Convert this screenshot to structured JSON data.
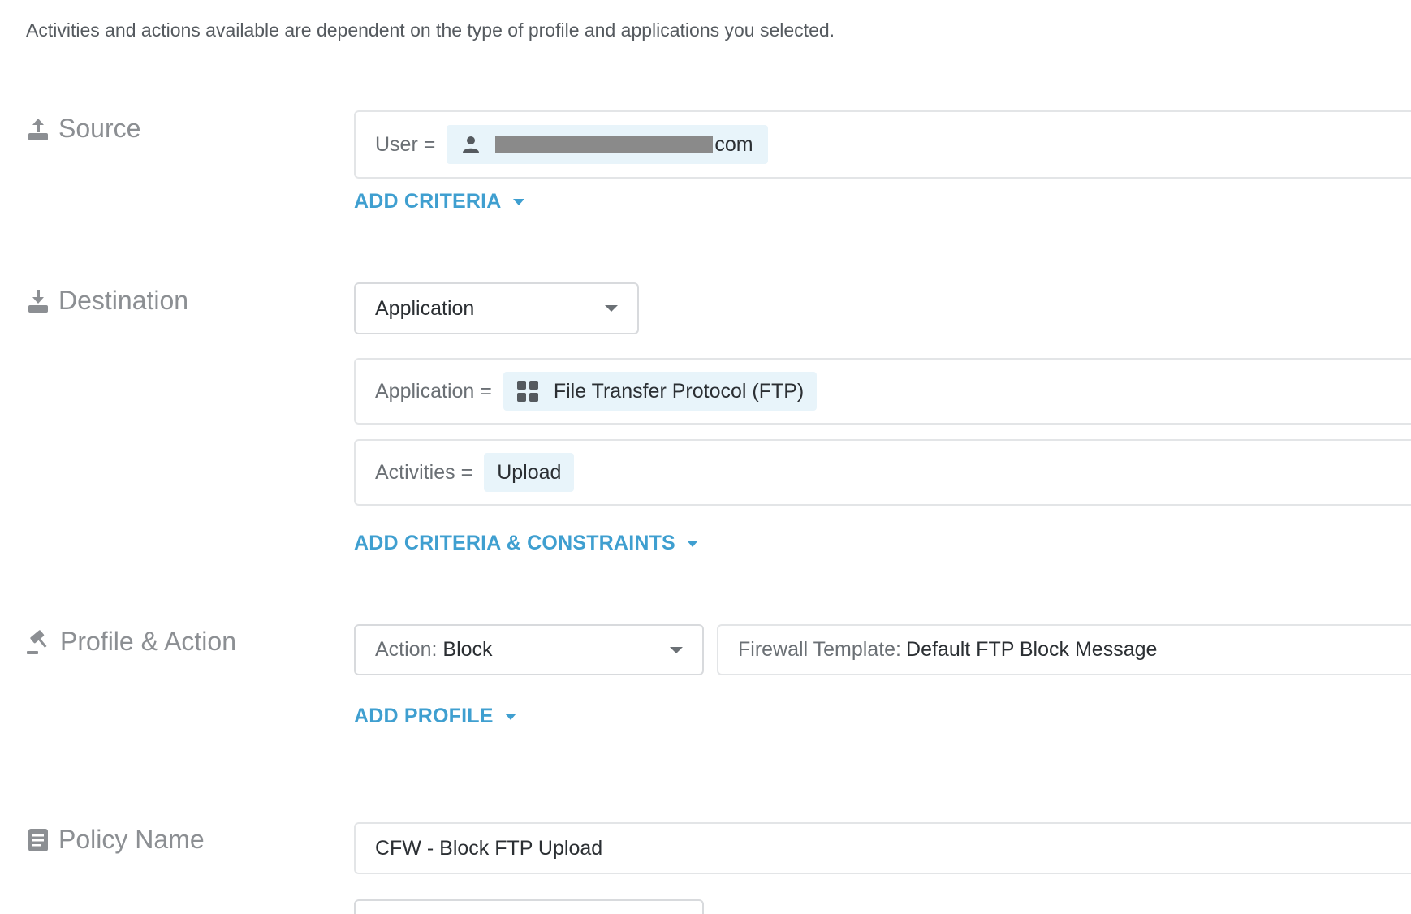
{
  "intro_text": "Activities and actions available are dependent on the type of profile and applications you selected.",
  "source": {
    "label": "Source",
    "user_criteria_label": "User =",
    "user_value_suffix": "com",
    "add_criteria_label": "ADD CRITERIA"
  },
  "destination": {
    "label": "Destination",
    "type_select_value": "Application",
    "application_criteria_label": "Application =",
    "application_value": "File Transfer Protocol (FTP)",
    "activities_criteria_label": "Activities =",
    "activities_value": "Upload",
    "add_criteria_label": "ADD CRITERIA & CONSTRAINTS"
  },
  "profile_action": {
    "label": "Profile & Action",
    "action_prefix": "Action:",
    "action_value": "Block",
    "template_prefix": "Firewall Template:",
    "template_value": "Default FTP Block Message",
    "add_profile_label": "ADD PROFILE"
  },
  "policy_name": {
    "label": "Policy Name",
    "value": "CFW - Block FTP Upload"
  },
  "icons": {
    "source": "upload-tray-icon",
    "destination": "download-tray-icon",
    "profile_action": "gavel-icon",
    "policy_name": "document-icon",
    "user": "person-icon",
    "application": "app-grid-icon"
  },
  "colors": {
    "accent": "#3f9fd0",
    "chip_background": "#e8f4fa",
    "section_label": "#8c8f93"
  }
}
